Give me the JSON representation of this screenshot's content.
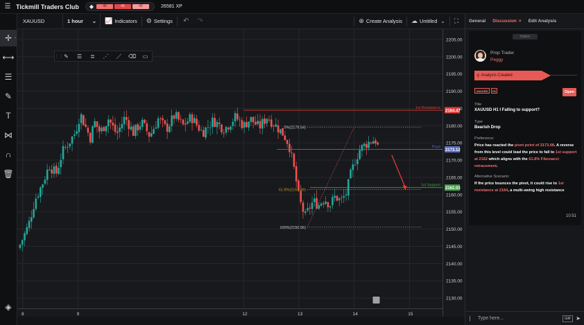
{
  "topbar": {
    "brand": "Tickmill Traders Club",
    "xp_segments": [
      "40",
      "41",
      "42"
    ],
    "xp_value": "26581 XP",
    "menu_icon": "hamburger-icon",
    "badge_icon": "diamond-icon"
  },
  "left_toolbar": {
    "tools": [
      "crosshair-icon",
      "horizontal-line-icon",
      "channel-icon",
      "brush-icon",
      "text-icon",
      "pattern-icon",
      "magnet-icon",
      "trash-icon"
    ],
    "bottom_tool": "layers-icon"
  },
  "chart_header": {
    "symbol": "XAUUSD",
    "interval": "1 hour",
    "indicators_label": "Indicators",
    "settings_label": "Settings",
    "create_analysis_label": "Create Analysis",
    "layout_name": "Untitled"
  },
  "draw_toolbar": {
    "tools": [
      "pencil-icon",
      "fib-icon",
      "fib-levels-icon",
      "path-icon",
      "line-icon",
      "eraser-icon",
      "rectangle-icon"
    ]
  },
  "chart_data": {
    "type": "candlestick",
    "symbol": "XAUUSD",
    "interval": "1 hour",
    "y_range": [
      2127,
      2208
    ],
    "x_range": [
      7.9,
      15.6
    ],
    "y_ticks": [
      "2205.00",
      "2200.00",
      "2195.00",
      "2190.00",
      "2185.00",
      "2180.00",
      "2175.00",
      "2170.00",
      "2165.00",
      "2160.00",
      "2155.00",
      "2150.00",
      "2145.00",
      "2140.00",
      "2135.00",
      "2130.00"
    ],
    "x_ticks": [
      {
        "t": 8,
        "label": "8"
      },
      {
        "t": 9,
        "label": "9"
      },
      {
        "t": 12,
        "label": "12"
      },
      {
        "t": 13,
        "label": "13"
      },
      {
        "t": 14,
        "label": "14"
      },
      {
        "t": 15,
        "label": "15"
      }
    ],
    "grid": true,
    "candle_keys": [
      [
        7.95,
        2145.5
      ],
      [
        8.1,
        2151.0
      ],
      [
        8.22,
        2158.5
      ],
      [
        8.35,
        2163.0
      ],
      [
        8.48,
        2168.5
      ],
      [
        8.6,
        2166.0
      ],
      [
        8.72,
        2172.5
      ],
      [
        8.85,
        2175.5
      ],
      [
        8.95,
        2178.0
      ],
      [
        9.04,
        2183.5
      ],
      [
        9.14,
        2179.5
      ],
      [
        9.22,
        2176.5
      ],
      [
        9.3,
        2181.0
      ],
      [
        9.4,
        2178.0
      ],
      [
        9.55,
        2182.0
      ],
      [
        9.7,
        2177.5
      ],
      [
        9.85,
        2182.5
      ],
      [
        10.0,
        2178.0
      ],
      [
        10.15,
        2181.0
      ],
      [
        10.3,
        2177.0
      ],
      [
        10.45,
        2182.0
      ],
      [
        10.6,
        2179.0
      ],
      [
        10.75,
        2183.0
      ],
      [
        10.9,
        2180.0
      ],
      [
        11.05,
        2182.5
      ],
      [
        11.25,
        2178.0
      ],
      [
        11.45,
        2181.5
      ],
      [
        11.65,
        2179.0
      ],
      [
        11.85,
        2182.5
      ],
      [
        12.0,
        2180.0
      ],
      [
        12.12,
        2182.0
      ],
      [
        12.28,
        2179.5
      ],
      [
        12.42,
        2182.5
      ],
      [
        12.58,
        2180.0
      ],
      [
        12.72,
        2177.5
      ],
      [
        12.82,
        2174.5
      ],
      [
        12.88,
        2170.0
      ],
      [
        12.94,
        2165.0
      ],
      [
        13.0,
        2159.0
      ],
      [
        13.06,
        2156.0
      ],
      [
        13.12,
        2153.5
      ],
      [
        13.18,
        2156.0
      ],
      [
        13.26,
        2158.0
      ],
      [
        13.36,
        2157.0
      ],
      [
        13.46,
        2159.0
      ],
      [
        13.56,
        2157.0
      ],
      [
        13.66,
        2159.5
      ],
      [
        13.76,
        2158.0
      ],
      [
        13.86,
        2160.5
      ],
      [
        13.94,
        2166.0
      ],
      [
        14.02,
        2170.0
      ],
      [
        14.1,
        2173.0
      ],
      [
        14.2,
        2174.5
      ],
      [
        14.3,
        2175.5
      ],
      [
        14.38,
        2176.0
      ],
      [
        14.44,
        2173.5
      ]
    ],
    "annotations": {
      "resistance": {
        "price": 2184.47,
        "label": "1st Resistance",
        "tag": "2184.47"
      },
      "pivot": {
        "price": 2173.12,
        "label": "Pivot",
        "tag": "2173.12"
      },
      "support": {
        "price": 2162.03,
        "label": "1st Support",
        "tag": "2162.03"
      },
      "fib_levels": [
        {
          "price": 2179.54,
          "label": "0%(2179.54)"
        },
        {
          "price": 2161.49,
          "label": "61.8%(2161.49)"
        },
        {
          "price": 2150.56,
          "label": "100%(2150.56)"
        }
      ],
      "fib_range": {
        "t_start": 13.15,
        "t_end": 14.0
      },
      "arrow": {
        "from": [
          14.68,
          2171.5
        ],
        "to": [
          14.92,
          2161.5
        ]
      }
    },
    "colors": {
      "up": "#26a69a",
      "down": "#ef5350",
      "resistance": "#e53935",
      "pivot": "#5c6bc0",
      "support": "#43a047",
      "fib": "#9e9e9e",
      "arrow": "#e53935"
    }
  },
  "panel": {
    "tabs": [
      {
        "label": "General",
        "active": false
      },
      {
        "label": "Discussion",
        "active": true,
        "close": "×"
      },
      {
        "label": "Edit Analysis",
        "active": false
      }
    ],
    "today_label": "TODAY",
    "author_role": "Prop Trader",
    "author_name": "Peggy",
    "status": "Analysis Created",
    "badges": [
      "XAUUSD",
      "H1"
    ],
    "open_label": "Open",
    "title_label": "Title",
    "title_value": "XAUUSD H1 I Falling to support?",
    "type_label": "Type",
    "type_value": "Bearish Drop",
    "preference_label": "Preference:",
    "preference_parts": [
      {
        "text": "Price has reacted the ",
        "hl": false
      },
      {
        "text": "pivot point of 2173.68",
        "hl": true
      },
      {
        "text": ". A reverse from this level could lead the price to fall to ",
        "hl": false
      },
      {
        "text": "1st support at 2162",
        "hl": true
      },
      {
        "text": " which aligns with the ",
        "hl": false
      },
      {
        "text": "61.8% Fibonacci retracement",
        "hl": true
      },
      {
        "text": ".",
        "hl": false
      }
    ],
    "alt_label": "Alternative Scenario:",
    "alt_parts": [
      {
        "text": "If the price bounces the pivot, it could rise to ",
        "hl": false
      },
      {
        "text": "1st resistance at 2184",
        "hl": true
      },
      {
        "text": ", a multi-swing high resistance",
        "hl": false
      }
    ],
    "time": "10:51",
    "composer_placeholder": "Type here...",
    "gif_label": "GIF"
  }
}
